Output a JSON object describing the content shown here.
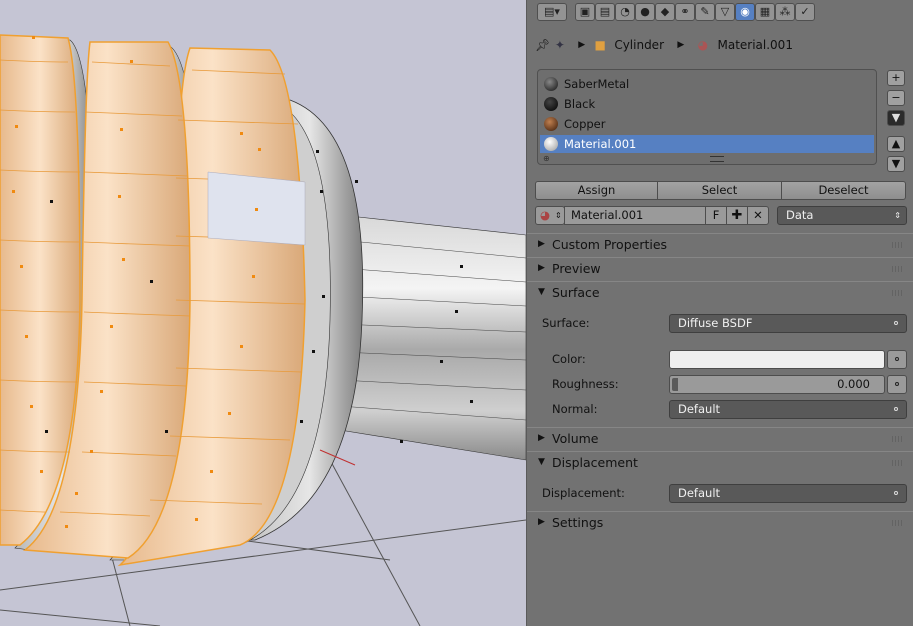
{
  "context": {
    "object_name": "Cylinder",
    "material_name": "Material.001"
  },
  "material_slots": [
    {
      "name": "SaberMetal",
      "ball_color": "#2a2a2a"
    },
    {
      "name": "Black",
      "ball_color": "#0d0d0d"
    },
    {
      "name": "Copper",
      "ball_color": "#6b3a1a"
    },
    {
      "name": "Material.001",
      "ball_color": "#dcdcdc"
    }
  ],
  "selected_slot": "Material.001",
  "slot_actions": {
    "assign": "Assign",
    "select": "Select",
    "deselect": "Deselect"
  },
  "material_block": {
    "name": "Material.001",
    "fake_user": "F",
    "link": "Data"
  },
  "sections": {
    "custom_properties": "Custom Properties",
    "preview": "Preview",
    "surface": "Surface",
    "volume": "Volume",
    "displacement": "Displacement",
    "settings": "Settings"
  },
  "surface": {
    "surface_label": "Surface:",
    "surface_value": "Diffuse BSDF",
    "color_label": "Color:",
    "color_value": "#efefef",
    "roughness_label": "Roughness:",
    "roughness_value": "0.000",
    "normal_label": "Normal:",
    "normal_value": "Default"
  },
  "displacement": {
    "label": "Displacement:",
    "value": "Default"
  },
  "colors": {
    "accent": "#5680c2",
    "panel_bg": "#727272",
    "viewport_bg": "#c5c5d4",
    "selection_orange": "#f0a030"
  }
}
